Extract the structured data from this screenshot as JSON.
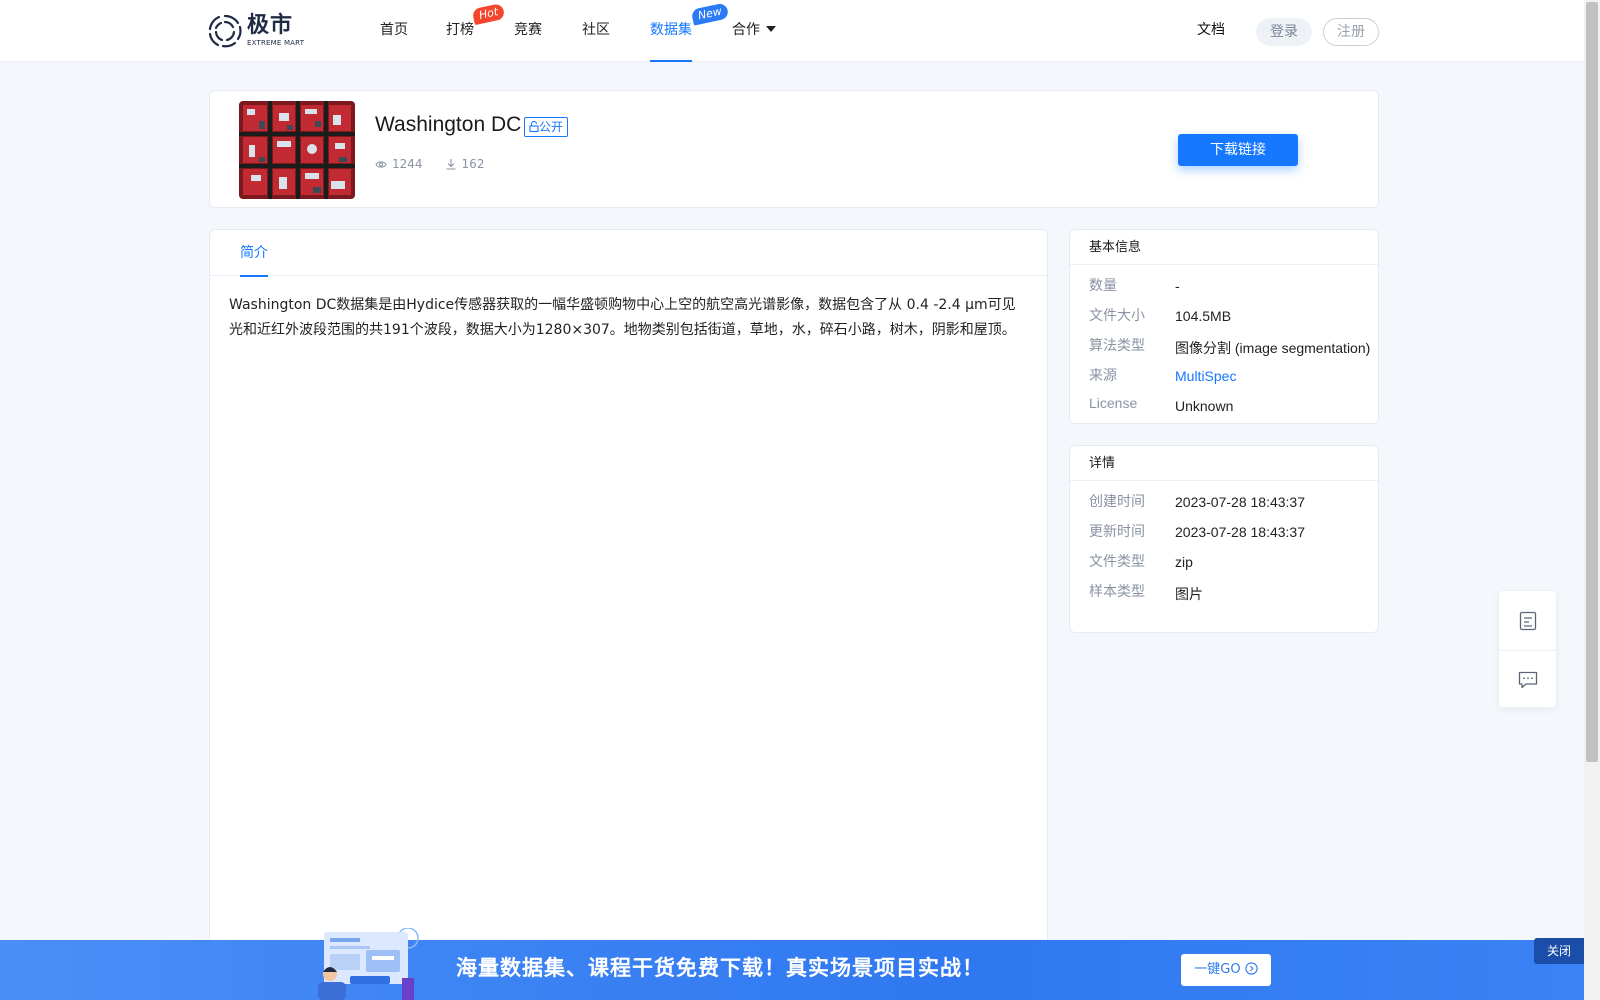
{
  "header": {
    "logo_cn": "极市",
    "logo_en": "EXTREME MART",
    "nav": [
      {
        "label": "首页",
        "badge": ""
      },
      {
        "label": "打榜",
        "badge": "Hot"
      },
      {
        "label": "竞赛",
        "badge": ""
      },
      {
        "label": "社区",
        "badge": ""
      },
      {
        "label": "数据集",
        "badge": "New",
        "active": true
      },
      {
        "label": "合作",
        "badge": "",
        "dropdown": true
      }
    ],
    "docs": "文档",
    "login": "登录",
    "register": "注册"
  },
  "dataset": {
    "title": "Washington DC",
    "visibility": "公开",
    "views": "1244",
    "downloads": "162",
    "download_button": "下载链接"
  },
  "intro": {
    "tab": "简介",
    "text": "Washington DC数据集是由Hydice传感器获取的一幅华盛顿购物中心上空的航空高光谱影像，数据包含了从 0.4 -2.4 μm可见光和近红外波段范围的共191个波段，数据大小为1280×307。地物类别包括街道，草地，水，碎石小路，树木，阴影和屋顶。"
  },
  "basic_info": {
    "title": "基本信息",
    "rows": [
      {
        "label": "数量",
        "value": "-"
      },
      {
        "label": "文件大小",
        "value": "104.5MB"
      },
      {
        "label": "算法类型",
        "value": "图像分割 (image segmentation)"
      },
      {
        "label": "来源",
        "value": "MultiSpec"
      },
      {
        "label": "License",
        "value": "Unknown"
      }
    ]
  },
  "details": {
    "title": "详情",
    "rows": [
      {
        "label": "创建时间",
        "value": "2023-07-28 18:43:37"
      },
      {
        "label": "更新时间",
        "value": "2023-07-28 18:43:37"
      },
      {
        "label": "文件类型",
        "value": "zip"
      },
      {
        "label": "样本类型",
        "value": "图片"
      }
    ]
  },
  "promo": {
    "text": "海量数据集、课程干货免费下载！真实场景项目实战！",
    "button": "一键GO",
    "close": "关闭"
  },
  "colors": {
    "accent": "#1677ff",
    "hot_badge": "#f5462d",
    "new_badge": "#2a7bf5",
    "banner": "#2f78f0"
  },
  "icons": [
    "logo-mark-icon",
    "eye-icon",
    "download-icon",
    "document-icon",
    "feedback-icon",
    "arrow-circle-icon",
    "caret-down-icon"
  ]
}
